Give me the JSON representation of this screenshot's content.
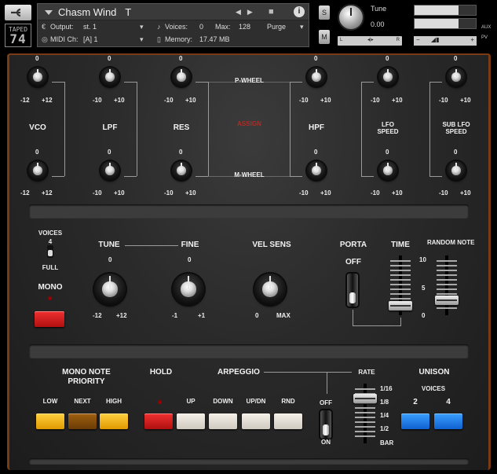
{
  "header": {
    "logo_line1": "TAPED",
    "logo_line2": "74",
    "instrument_name": "Chasm Wind",
    "instrument_suffix": "T",
    "output_label": "Output:",
    "output_value": "st. 1",
    "voices_label": "Voices:",
    "voices_value": "0",
    "max_label": "Max:",
    "max_value": "128",
    "purge_label": "Purge",
    "midi_label": "MIDI Ch:",
    "midi_value": "[A] 1",
    "memory_label": "Memory:",
    "memory_value": "17.47 MB",
    "solo_label": "S",
    "mute_label": "M",
    "tune_label": "Tune",
    "tune_value": "0.00",
    "pan_left": "L",
    "pan_right": "R",
    "vol_minus": "−",
    "vol_plus": "+",
    "aux_label": "AUX",
    "pv_label": "PV"
  },
  "mod_section": {
    "top_values": [
      "0",
      "0",
      "0",
      "0",
      "0",
      "0"
    ],
    "top_ranges": [
      [
        "-12",
        "+12"
      ],
      [
        "-10",
        "+10"
      ],
      [
        "-10",
        "+10"
      ],
      [
        "-10",
        "+10"
      ],
      [
        "-10",
        "+10"
      ],
      [
        "-10",
        "+10"
      ]
    ],
    "bottom_values": [
      "0",
      "0",
      "0",
      "0",
      "0",
      "0"
    ],
    "bottom_ranges": [
      [
        "-12",
        "+12"
      ],
      [
        "-10",
        "+10"
      ],
      [
        "-10",
        "+10"
      ],
      [
        "-10",
        "+10"
      ],
      [
        "-10",
        "+10"
      ],
      [
        "-10",
        "+10"
      ]
    ],
    "labels": [
      "VCO",
      "LPF",
      "RES",
      "HPF",
      "LFO\nSPEED",
      "SUB LFO\nSPEED"
    ],
    "pwheel": "P-WHEEL",
    "assign": "ASSIGN",
    "mwheel": "M-WHEEL"
  },
  "mid_section": {
    "voices_label": "VOICES",
    "voices_4": "4",
    "voices_full": "FULL",
    "mono_label": "MONO",
    "tune_label": "TUNE",
    "tune_top": "0",
    "tune_min": "-12",
    "tune_max": "+12",
    "fine_label": "FINE",
    "fine_top": "0",
    "fine_min": "-1",
    "fine_max": "+1",
    "velsens_label": "VEL SENS",
    "velsens_min": "0",
    "velsens_max": "MAX",
    "porta_label": "PORTA",
    "porta_off": "OFF",
    "time_label": "TIME",
    "random_label": "RANDOM\nNOTE",
    "random_ticks": [
      "10",
      "5",
      "0"
    ],
    "random_level": 0.2,
    "time_level": 0.1
  },
  "bottom_section": {
    "mono_priority_label": "MONO NOTE\nPRIORITY",
    "low": "LOW",
    "next": "NEXT",
    "high": "HIGH",
    "hold_label": "HOLD",
    "arp_label": "ARPEGGIO",
    "up": "UP",
    "down": "DOWN",
    "updn": "UP/DN",
    "rnd": "RND",
    "arp_off": "OFF",
    "arp_on": "ON",
    "rate_label": "RATE",
    "rate_ticks": [
      "1/16",
      "1/8",
      "1/4",
      "1/2",
      "BAR"
    ],
    "rate_level": 0.8,
    "unison_label": "UNISON",
    "voices_label": "VOICES",
    "unison_2": "2",
    "unison_4": "4"
  },
  "colors": {
    "panel_trim": "#7a3a12",
    "active_red": "#d02020",
    "unison_blue": "#2080f0",
    "priority_yellow": "#f0b020"
  }
}
